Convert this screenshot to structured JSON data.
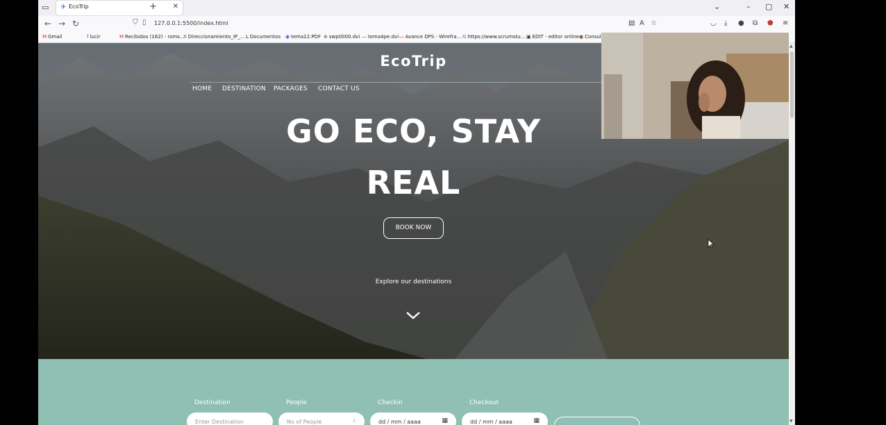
{
  "browser": {
    "tab_title": "EcoTrip",
    "new_tab_symbol": "+",
    "url": "127.0.0.1:5500/index.html"
  },
  "bookmarks": [
    {
      "label": "Gmail",
      "icon": "M",
      "color": "#d93025"
    },
    {
      "label": "lucir",
      "icon": "f",
      "color": "#1877f2"
    },
    {
      "label": "Recibidos (162) - roms...",
      "icon": "M",
      "color": "#d93025"
    },
    {
      "label": "Direccionamiento_IP_...",
      "icon": "X",
      "color": "#1d6f42"
    },
    {
      "label": "Documentos",
      "icon": "L",
      "color": "#222222"
    },
    {
      "label": "tema12.PDF",
      "icon": "◉",
      "color": "#3b5bdb"
    },
    {
      "label": "swp0000.dvi",
      "icon": "⊕",
      "color": "#555555"
    },
    {
      "label": "tema4pe.dvi",
      "icon": "—",
      "color": "#555555"
    },
    {
      "label": "Avance DPS - Wirefra...",
      "icon": "▭",
      "color": "#e8590c"
    },
    {
      "label": "https://www.scrumstu...",
      "icon": "G",
      "color": "#1a73e8"
    },
    {
      "label": "EDIT - editor online",
      "icon": "▣",
      "color": "#333333"
    },
    {
      "label": "Consul",
      "icon": "●",
      "color": "#8a6d3b"
    }
  ],
  "site": {
    "logo": "EcoTrip",
    "menu": [
      "HOME",
      "DESTINATION",
      "PACKAGES",
      "CONTACT US"
    ],
    "headline_line1": "GO ECO, STAY",
    "headline_line2": "REAL",
    "cta_label": "BOOK NOW",
    "explore_text": "Explore our destinations",
    "booking": {
      "fields": [
        {
          "label": "Destination",
          "placeholder": "Enter Destination"
        },
        {
          "label": "People",
          "placeholder": "No of People"
        },
        {
          "label": "Checkin",
          "placeholder": "dd / mm / aaaa"
        },
        {
          "label": "Checkout",
          "placeholder": "dd / mm / aaaa"
        }
      ]
    }
  },
  "colors": {
    "booking_bg": "#90bfb4",
    "hero_text": "#ffffff"
  }
}
